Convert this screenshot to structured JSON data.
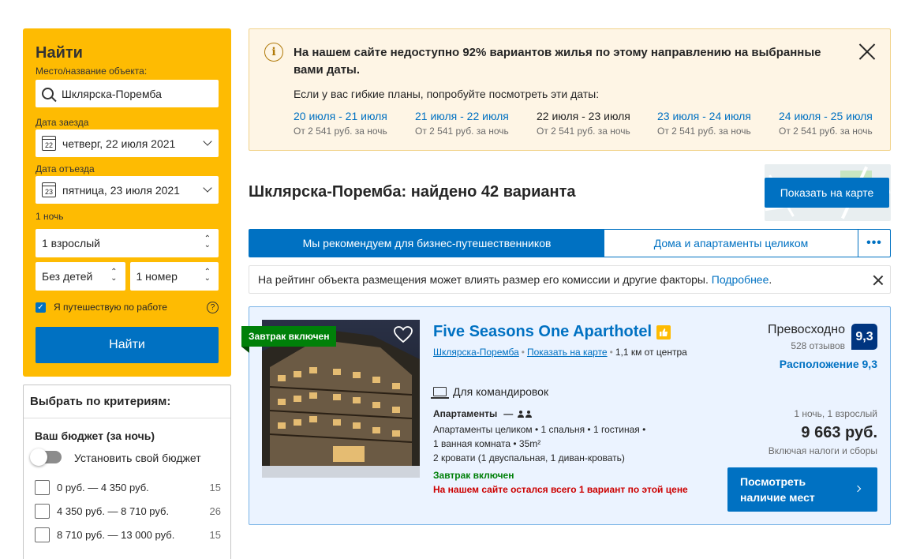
{
  "search": {
    "title": "Найти",
    "destination_label": "Место/название объекта:",
    "destination_value": "Шклярска-Поремба",
    "checkin_label": "Дата заезда",
    "checkin_day": "22",
    "checkin_value": "четверг, 22 июля 2021",
    "checkout_label": "Дата отъезда",
    "checkout_day": "23",
    "checkout_value": "пятница, 23 июля 2021",
    "nights": "1 ночь",
    "adults": "1 взрослый",
    "children": "Без детей",
    "rooms": "1 номер",
    "business_checkbox_label": "Я путешествую по работе",
    "business_checked": true,
    "help_icon": "?",
    "search_button": "Найти"
  },
  "filters": {
    "title": "Выбрать по критериям:",
    "budget_title": "Ваш бюджет (за ночь)",
    "toggle_label": "Установить свой бюджет",
    "price_ranges": [
      {
        "label": "0 руб. — 4 350 руб.",
        "count": "15"
      },
      {
        "label": "4 350 руб. — 8 710 руб.",
        "count": "26"
      },
      {
        "label": "8 710 руб. — 13 000 руб.",
        "count": "15"
      }
    ]
  },
  "alert": {
    "icon": "info-icon",
    "title": "На нашем сайте недоступно 92% вариантов жилья по этому направлению на выбранные вами даты.",
    "subtitle": "Если у вас гибкие планы, попробуйте посмотреть эти даты:",
    "date_options": [
      {
        "dates": "20 июля - 21 июля",
        "price": "От 2 541 руб. за ночь",
        "link": true
      },
      {
        "dates": "21 июля - 22 июля",
        "price": "От 2 541 руб. за ночь",
        "link": true
      },
      {
        "dates": "22 июля - 23 июля",
        "price": "От 2 541 руб. за ночь",
        "link": false
      },
      {
        "dates": "23 июля - 24 июля",
        "price": "От 2 541 руб. за ночь",
        "link": true
      },
      {
        "dates": "24 июля - 25 июля",
        "price": "От 2 541 руб. за ночь",
        "link": true
      }
    ]
  },
  "results": {
    "title": "Шклярска-Поремба: найдено 42 варианта",
    "map_button": "Показать на карте"
  },
  "tabs": [
    {
      "label": "Мы рекомендуем для бизнес-путешественников",
      "active": true
    },
    {
      "label": "Дома и апартаменты целиком",
      "active": false
    },
    {
      "label": "•••",
      "active": false
    }
  ],
  "notice": {
    "text": "На рейтинг объекта размещения может влиять размер его комиссии и другие факторы. ",
    "link": "Подробнее",
    "end": "."
  },
  "property": {
    "badge": "Завтрак включен",
    "name": "Five Seasons One Aparthotel",
    "city_link": "Шклярска-Поремба",
    "map_link": "Показать на карте",
    "distance": "1,1 км от центра",
    "business_label": "Для командировок",
    "room_type": "Апартаменты",
    "room_dash": "—",
    "room_lines": [
      "Апартаменты целиком  • 1 спальня • 1 гостиная •",
      "1 ванная комната • 35m²",
      "2 кровати (1 двуспальная, 1 диван-кровать)"
    ],
    "breakfast": "Завтрак включен",
    "scarcity": "На нашем сайте остался всего 1 вариант по этой цене",
    "rating_word": "Превосходно",
    "reviews": "528 отзывов",
    "score": "9,3",
    "location_score": "Расположение 9,3",
    "stay_info": "1 ночь, 1 взрослый",
    "price": "9 663 руб.",
    "taxes": "Включая налоги и сборы",
    "availability_button": "Посмотреть наличие мест"
  },
  "colors": {
    "brand_yellow": "#febb02",
    "brand_blue": "#0071c2",
    "dark_blue": "#003580",
    "green": "#008009",
    "red": "#cc0000"
  }
}
